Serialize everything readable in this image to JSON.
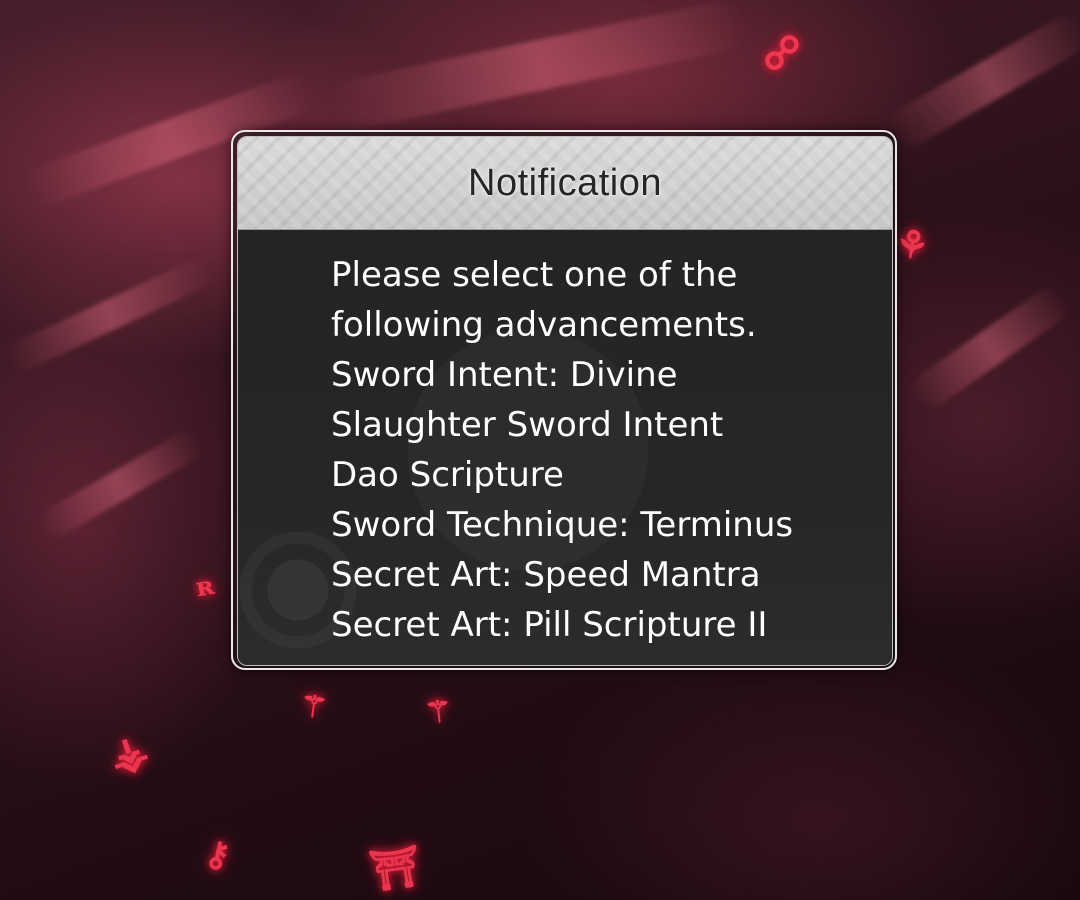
{
  "dialog": {
    "title": "Notification",
    "prompt_lines": [
      "Please select one of the",
      "following advancements."
    ],
    "options": [
      {
        "lines": [
          "Sword Intent: Divine",
          "Slaughter Sword Intent"
        ]
      },
      {
        "lines": [
          "Dao Scripture"
        ]
      },
      {
        "lines": [
          "Sword Technique: Terminus"
        ]
      },
      {
        "lines": [
          "Secret Art: Speed Mantra"
        ]
      },
      {
        "lines": [
          "Secret Art: Pill Scripture II"
        ]
      }
    ]
  },
  "colors": {
    "background": "#2b1019",
    "glyph_accent": "#ff3b55",
    "dialog_body": "#242424",
    "dialog_header": "#d0d0d0",
    "text": "#ffffff"
  },
  "icons": [
    "red-rune-glyph"
  ]
}
